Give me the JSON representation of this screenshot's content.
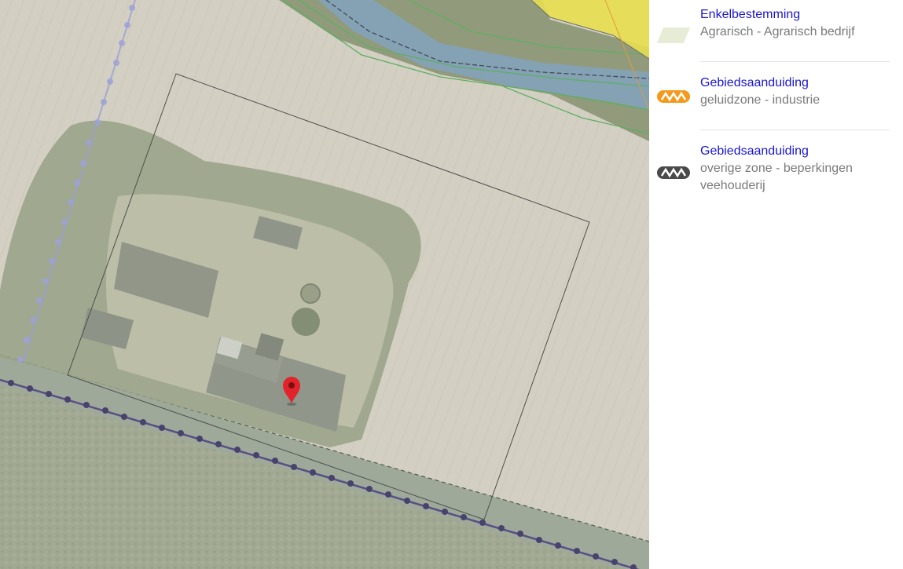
{
  "legend": {
    "items": [
      {
        "title": "Enkelbestemming",
        "description": "Agrarisch - Agrarisch bedrijf",
        "swatch": "parallelogram-swatch",
        "color": "#e6ecd5"
      },
      {
        "title": "Gebiedsaanduiding",
        "description": "geluidzone - industrie",
        "swatch": "zigzag-swatch",
        "color": "#f39a1e"
      },
      {
        "title": "Gebiedsaanduiding",
        "description": "overige zone - beperkingen veehouderij",
        "swatch": "zigzag-swatch",
        "color": "#4a4a4a"
      }
    ]
  },
  "map": {
    "marker": "map-pin-icon",
    "marker_color": "#e3232b",
    "plan_fill_color": "#d9e3c2",
    "water_color": "#6e93b8",
    "yellow_zone_color": "#e9dd32",
    "boundary_color": "#2a2a4a",
    "dotted_line_color": "#8a8fd6"
  }
}
